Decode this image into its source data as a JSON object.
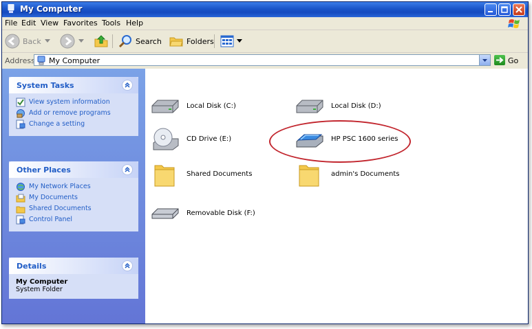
{
  "window": {
    "title": "My Computer"
  },
  "menu": [
    "File",
    "Edit",
    "View",
    "Favorites",
    "Tools",
    "Help"
  ],
  "toolbar": {
    "back": "Back",
    "search": "Search",
    "folders": "Folders"
  },
  "address": {
    "label": "Address",
    "value": "My Computer",
    "go": "Go"
  },
  "system_tasks": {
    "title": "System Tasks",
    "items": [
      "View system information",
      "Add or remove programs",
      "Change a setting"
    ]
  },
  "other_places": {
    "title": "Other Places",
    "items": [
      "My Network Places",
      "My Documents",
      "Shared Documents",
      "Control Panel"
    ]
  },
  "details": {
    "title": "Details",
    "name": "My Computer",
    "type": "System Folder"
  },
  "items": [
    {
      "label": "Local Disk (C:)",
      "icon": "hard-drive-icon"
    },
    {
      "label": "Local Disk (D:)",
      "icon": "hard-drive-icon"
    },
    {
      "label": "CD Drive (E:)",
      "icon": "cd-drive-icon"
    },
    {
      "label": "HP PSC 1600 series",
      "icon": "scanner-icon"
    },
    {
      "label": "Shared Documents",
      "icon": "folder-icon"
    },
    {
      "label": "admin's Documents",
      "icon": "folder-icon"
    },
    {
      "label": "Removable Disk (F:)",
      "icon": "removable-disk-icon"
    }
  ],
  "colors": {
    "title_bar": "#1a54c8",
    "task_pane": "#7ba2e7",
    "link": "#215dc6",
    "highlight_ring": "#c2262e"
  }
}
